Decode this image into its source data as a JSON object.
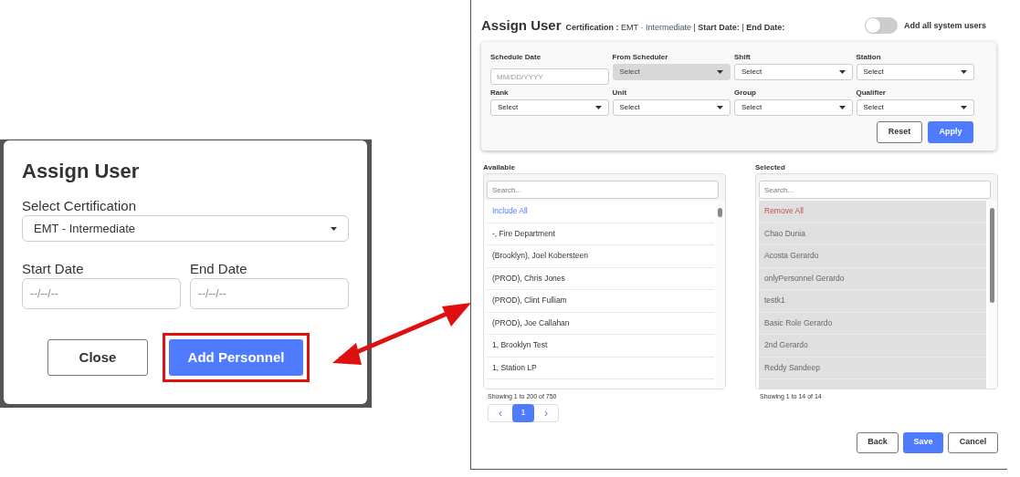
{
  "modal": {
    "title": "Assign User",
    "certification": {
      "label": "Select Certification",
      "value": "EMT - Intermediate"
    },
    "start_date": {
      "label": "Start Date",
      "placeholder": "--/--/--"
    },
    "end_date": {
      "label": "End Date",
      "placeholder": "--/--/--"
    },
    "buttons": [
      {
        "label": "Close",
        "kind": "secondary",
        "highlighted": false
      },
      {
        "label": "Add Personnel",
        "kind": "primary",
        "highlighted": true
      }
    ]
  },
  "panel": {
    "title": "Assign User",
    "certification_label": "Certification :",
    "certification_value": "EMT",
    "certification_sep": "-",
    "certification_level": "Intermediate",
    "separator": "|",
    "start_label": "Start Date:",
    "end_label": "End Date:",
    "toggle": {
      "label": "Add all system users",
      "on": false
    },
    "filters": [
      {
        "label": "Schedule Date",
        "kind": "date",
        "placeholder": "MM/DD/YYYY",
        "disabled": false
      },
      {
        "label": "From Scheduler",
        "kind": "select",
        "value": "Select",
        "disabled": true
      },
      {
        "label": "Shift",
        "kind": "select",
        "value": "Select",
        "disabled": false
      },
      {
        "label": "Station",
        "kind": "select",
        "value": "Select",
        "disabled": false
      },
      {
        "label": "Rank",
        "kind": "select",
        "value": "Select",
        "disabled": false
      },
      {
        "label": "Unit",
        "kind": "select",
        "value": "Select",
        "disabled": false
      },
      {
        "label": "Group",
        "kind": "select",
        "value": "Select",
        "disabled": false
      },
      {
        "label": "Qualifier",
        "kind": "select",
        "value": "Select",
        "disabled": false
      }
    ],
    "filter_buttons": [
      {
        "label": "Reset",
        "kind": "secondary"
      },
      {
        "label": "Apply",
        "kind": "primary"
      }
    ],
    "lists": [
      {
        "title": "Available",
        "search_placeholder": "Search...",
        "disabled": false,
        "action": "Include All",
        "items": [
          "-, Fire Department",
          "(Brooklyn), Joel Kobersteen",
          "(PROD), Chris Jones",
          "(PROD), Clint Fulliam",
          "(PROD), Joe Callahan",
          "1, Brooklyn Test",
          "1, Station LP"
        ],
        "footer": "Showing 1 to 200 of 750"
      },
      {
        "title": "Selected",
        "search_placeholder": "Search...",
        "disabled": true,
        "action": "Remove All",
        "items": [
          "Chao Dunia",
          "Acosta Gerardo",
          "onlyPersonnel Gerardo",
          "testk1",
          "Basic Role Gerardo",
          "2nd Gerardo",
          "Reddy Sandeep"
        ],
        "footer": "Showing 1 to 14 of 14"
      }
    ],
    "pagination": {
      "prev": "‹",
      "next": "›",
      "pages": [
        {
          "label": "1",
          "selected": true
        }
      ]
    },
    "footer_buttons": [
      {
        "label": "Back",
        "kind": "secondary"
      },
      {
        "label": "Save",
        "kind": "primary"
      },
      {
        "label": "Cancel",
        "kind": "secondary"
      }
    ]
  }
}
